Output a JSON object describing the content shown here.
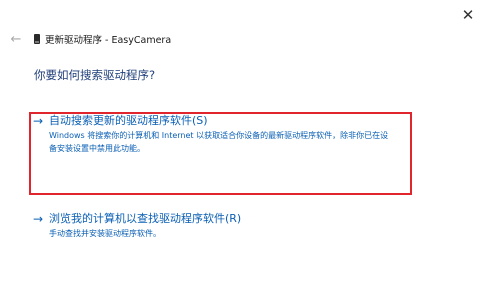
{
  "window": {
    "close_glyph": "✕",
    "back_glyph": "←",
    "title": "更新驱动程序 - EasyCamera"
  },
  "page": {
    "question": "你要如何搜索驱动程序?"
  },
  "options": [
    {
      "arrow": "→",
      "label": "自动搜索更新的驱动程序软件(S)",
      "description": "Windows 将搜索你的计算机和 Internet 以获取适合你设备的最新驱动程序软件，除非你已在设备安装设置中禁用此功能。"
    },
    {
      "arrow": "→",
      "label": "浏览我的计算机以查找驱动程序软件(R)",
      "description": "手动查找并安装驱动程序软件。"
    }
  ],
  "colors": {
    "link": "#0a5fb4",
    "heading": "#1f3f7a",
    "highlight": "#e0262c"
  },
  "icons": {
    "close": "close-icon",
    "back": "back-arrow-icon",
    "device": "device-icon",
    "option_arrow": "arrow-right-icon"
  }
}
